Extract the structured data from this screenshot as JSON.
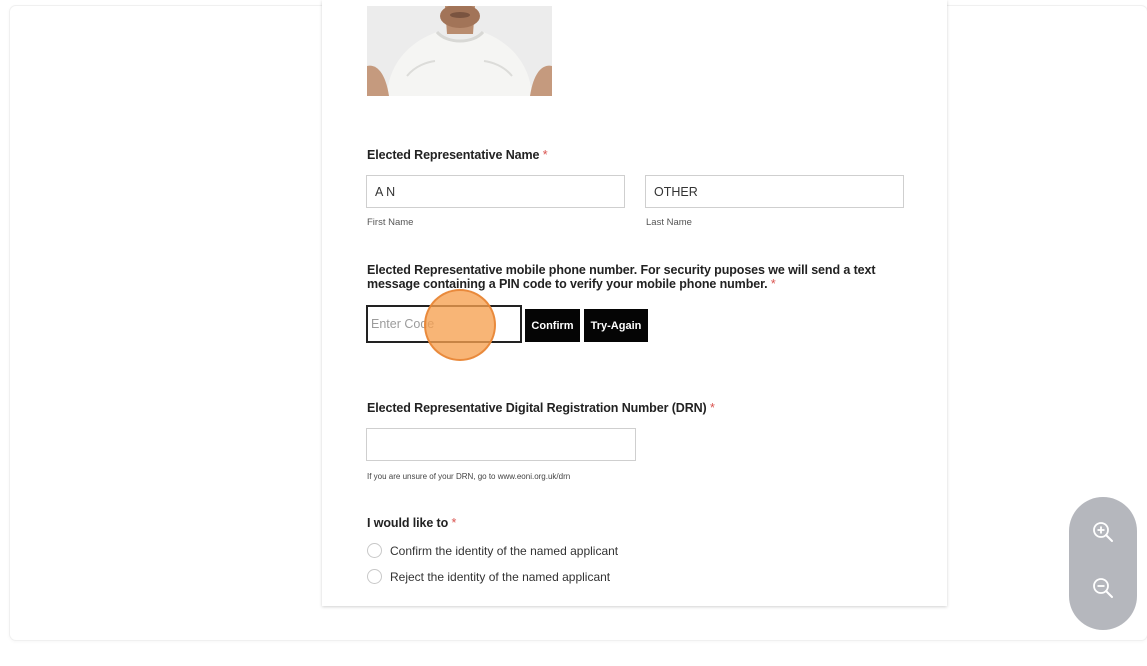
{
  "form": {
    "name_section": {
      "label": "Elected Representative Name",
      "required_mark": "*",
      "first_name_value": "A N",
      "last_name_value": "OTHER",
      "first_name_sublabel": "First Name",
      "last_name_sublabel": "Last Name"
    },
    "phone_section": {
      "label_line1": "Elected Representative mobile phone number. For security puposes we will send a text",
      "label_line2": "message containing a PIN code to verify your mobile phone number.",
      "required_mark": "*",
      "code_placeholder": "Enter Code",
      "confirm_label": "Confirm",
      "try_again_label": "Try-Again"
    },
    "drn_section": {
      "label": "Elected Representative Digital Registration Number (DRN)",
      "required_mark": "*",
      "value": "",
      "help_text": "If you are unsure of your DRN, go to www.eoni.org.uk/drn"
    },
    "action_section": {
      "label": "I would like to",
      "required_mark": "*",
      "options": [
        {
          "label": "Confirm the identity of the named applicant",
          "selected": false
        },
        {
          "label": "Reject the identity of the named applicant",
          "selected": false
        }
      ]
    }
  },
  "zoom_controls": {
    "zoom_in_icon": "zoom-in-icon",
    "zoom_out_icon": "zoom-out-icon"
  },
  "colors": {
    "required": "#d9534f",
    "button_bg": "#050505",
    "click_indicator": "#f6a050",
    "zoom_pill": "#b5b7bd"
  }
}
